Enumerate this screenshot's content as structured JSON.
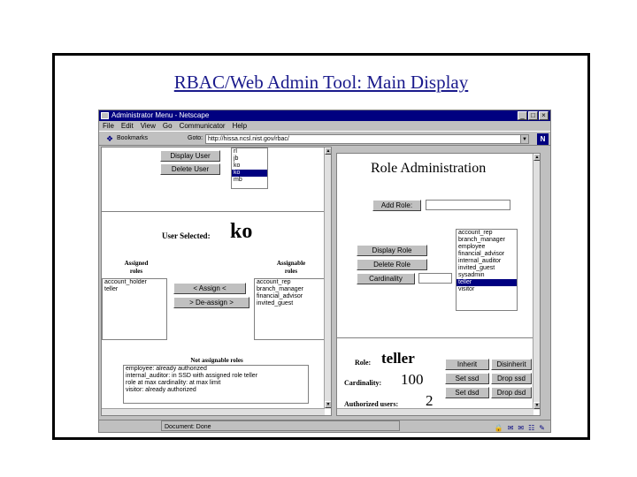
{
  "slide": {
    "title": "RBAC/Web Admin Tool: Main Display"
  },
  "window": {
    "title": "Administrator Menu - Netscape",
    "menu": [
      "File",
      "Edit",
      "View",
      "Go",
      "Communicator",
      "Help"
    ],
    "bookmarks_label": "Bookmarks",
    "goto_label": "Goto:",
    "url": "http://hissa.ncsl.nist.gov/rbac/",
    "logo": "N",
    "status": "Document: Done"
  },
  "left": {
    "display_user_label": "Display User",
    "delete_user_label": "Delete User",
    "users": [
      {
        "label": "rl",
        "selected": false
      },
      {
        "label": "jb",
        "selected": false
      },
      {
        "label": "ko",
        "selected": false
      },
      {
        "label": "ko",
        "selected": true
      },
      {
        "label": "mb",
        "selected": false
      }
    ],
    "user_selected_label": "User Selected:",
    "user_selected_value": "ko",
    "assigned_roles_label": [
      "Assigned",
      "roles"
    ],
    "assignable_roles_label": [
      "Assignable",
      "roles"
    ],
    "assigned_roles": [
      "account_holder",
      "teller"
    ],
    "assignable_roles": [
      "account_rep",
      "branch_manager",
      "financial_advisor",
      "invited_guest"
    ],
    "assign_label": "< Assign <",
    "deassign_label": "> De-assign >",
    "not_assignable_label": "Not assignable roles",
    "not_assignable": [
      "employee: already authorized",
      "internal_auditor: in SSD with assigned role teller",
      "role at max cardinality: at max limit",
      "visitor: already authorized"
    ]
  },
  "right": {
    "heading": "Role Administration",
    "add_role_label": "Add Role:",
    "roles": [
      {
        "label": "account_rep",
        "selected": false
      },
      {
        "label": "branch_manager",
        "selected": false
      },
      {
        "label": "employee",
        "selected": false
      },
      {
        "label": "financial_advisor",
        "selected": false
      },
      {
        "label": "internal_auditor",
        "selected": false
      },
      {
        "label": "invited_guest",
        "selected": false
      },
      {
        "label": "sysadmin",
        "selected": false
      },
      {
        "label": "teller",
        "selected": true
      },
      {
        "label": "visitor",
        "selected": false
      }
    ],
    "display_role_label": "Display Role",
    "delete_role_label": "Delete Role",
    "cardinality_button_label": "Cardinality",
    "role_label": "Role:",
    "role_value": "teller",
    "cardinality_label": "Cardinality:",
    "cardinality_value": "100",
    "authorized_label": "Authorized users:",
    "authorized_value": "2",
    "inherit_label": "Inherit",
    "disinherit_label": "Disinherit",
    "set_ssd_label": "Set ssd",
    "drop_ssd_label": "Drop ssd",
    "set_dsd_label": "Set dsd",
    "drop_dsd_label": "Drop dsd"
  }
}
